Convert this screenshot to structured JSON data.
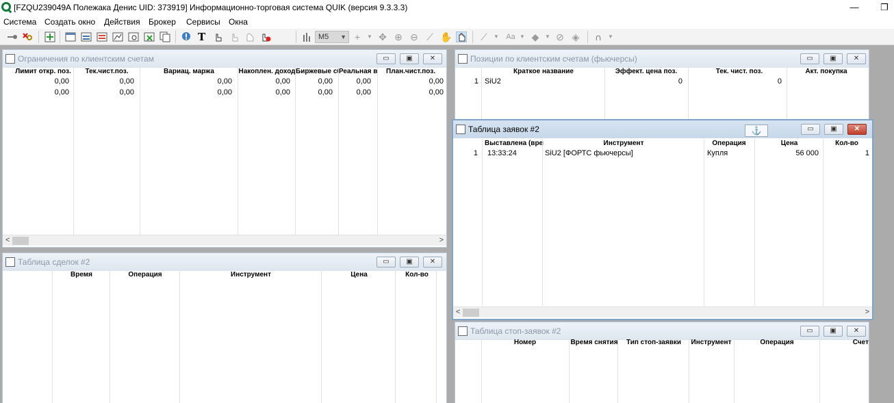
{
  "app": {
    "title": "[FZQU239049A Полежака Денис UID: 373919] Информационно-торговая система QUIK (версия 9.3.3.3)",
    "minimize_glyph": "—",
    "restore_glyph": "❐"
  },
  "menu": [
    "Система",
    "Создать окно",
    "Действия",
    "Брокер",
    "Сервисы",
    "Окна"
  ],
  "toolbar": {
    "interval": "M5",
    "font_label": "Aa"
  },
  "windows": {
    "limits": {
      "title": "Ограничения по клиентским счетам",
      "columns": [
        "Лимит откр. поз.",
        "Тек.чист.поз.",
        "Вариац. маржа",
        "Накоплен. доход",
        "Биржевые сб",
        "Реальная в.",
        "План.чист.поз."
      ],
      "rows": [
        [
          "0,00",
          "0,00",
          "0,00",
          "0,00",
          "0,00",
          "0,00",
          "0,00"
        ],
        [
          "0,00",
          "0,00",
          "0,00",
          "0,00",
          "0,00",
          "0,00",
          "0,00"
        ]
      ]
    },
    "positions": {
      "title": "Позиции по клиентским счетам (фьючерсы)",
      "columns": [
        "Краткое название",
        "Эффект. цена поз.",
        "Тек. чист. поз.",
        "Акт. покупка"
      ],
      "rows": [
        {
          "n": "1",
          "name": "SiU2",
          "price": "0",
          "net": "0"
        }
      ]
    },
    "orders": {
      "title": "Таблица заявок #2",
      "anchor": "⚓",
      "columns": [
        "Выставлена (врем",
        "Инструмент",
        "Операция",
        "Цена",
        "Кол-во"
      ],
      "rows": [
        {
          "n": "1",
          "time": "13:33:24",
          "instrument": "SiU2 [ФОРТС фьючерсы]",
          "operation": "Купля",
          "price": "56 000",
          "qty": "1"
        }
      ]
    },
    "deals": {
      "title": "Таблица сделок #2",
      "columns": [
        "Время",
        "Операция",
        "Инструмент",
        "Цена",
        "Кол-во"
      ]
    },
    "stop_orders": {
      "title": "Таблица стоп-заявок #2",
      "columns": [
        "Номер",
        "Время снятия",
        "Тип стоп-заявки",
        "Инструмент",
        "Операция",
        "Счет"
      ]
    }
  },
  "window_buttons": {
    "minimize": "▭",
    "maximize": "▣",
    "close": "✕"
  }
}
